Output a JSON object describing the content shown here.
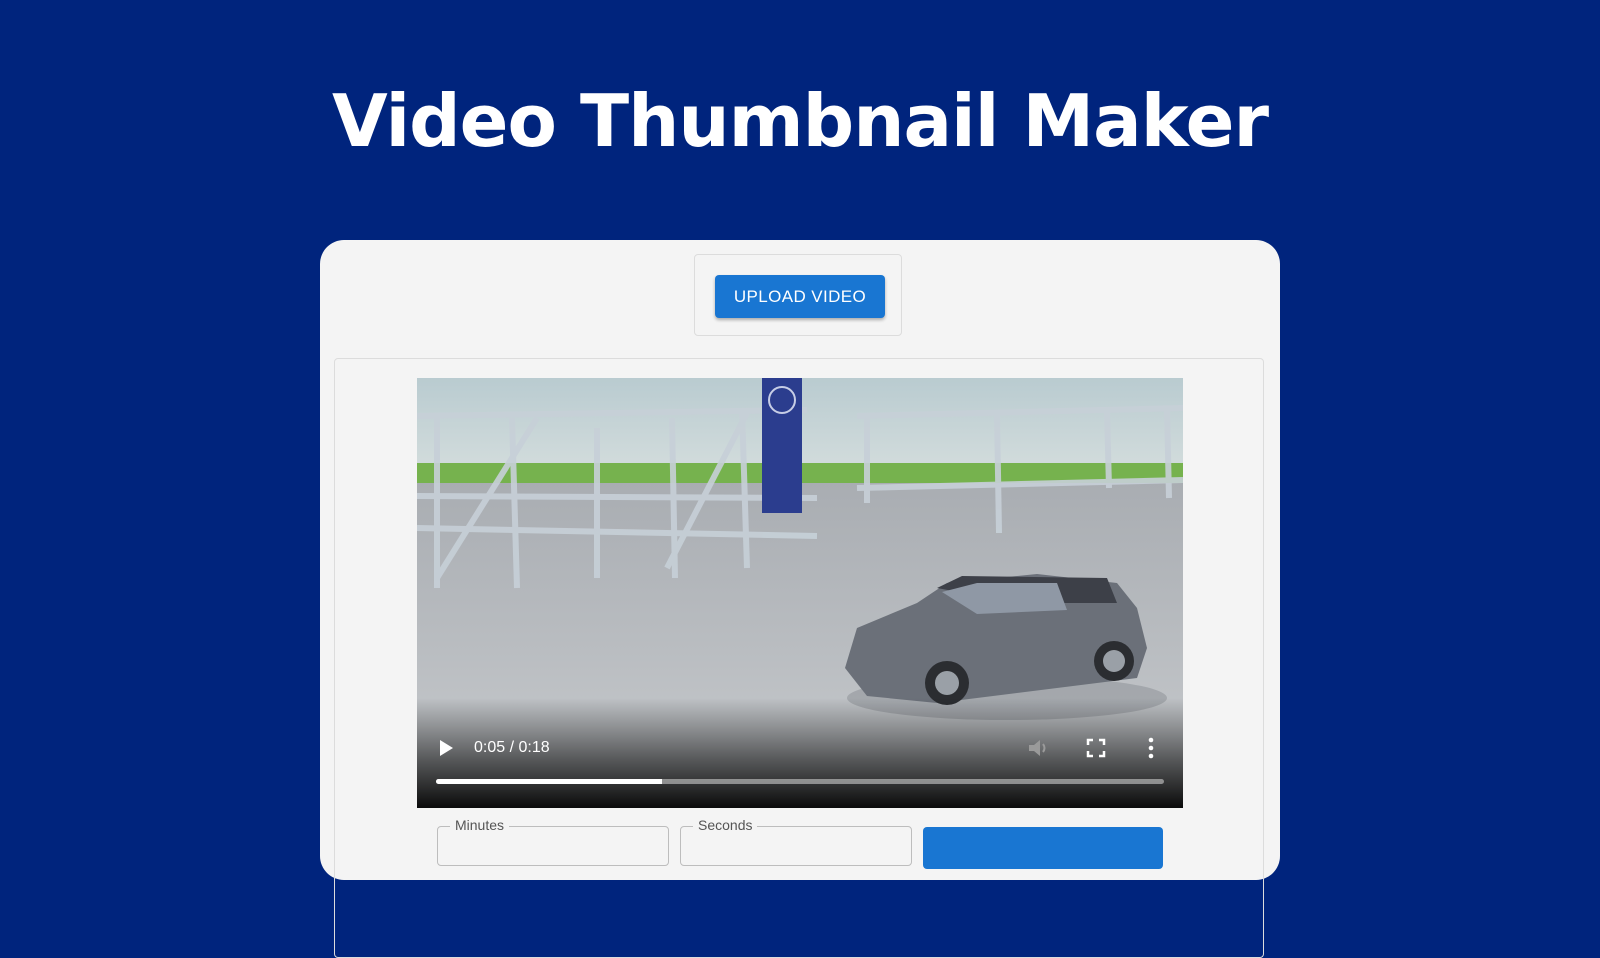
{
  "page": {
    "title": "Video Thumbnail Maker"
  },
  "upload": {
    "button_label": "UPLOAD VIDEO"
  },
  "player": {
    "current_time": "0:05",
    "duration": "0:18",
    "time_display": "0:05 / 0:18",
    "progress_fraction": 0.31,
    "icons": [
      "play-icon",
      "volume-icon",
      "fullscreen-icon",
      "more-options-icon"
    ]
  },
  "time_fields": {
    "minutes": {
      "label": "Minutes",
      "value": ""
    },
    "seconds": {
      "label": "Seconds",
      "value": ""
    }
  },
  "capture": {
    "button_label": ""
  },
  "colors": {
    "background": "#00247d",
    "card": "#f4f4f4",
    "primary_button": "#1976d2"
  }
}
